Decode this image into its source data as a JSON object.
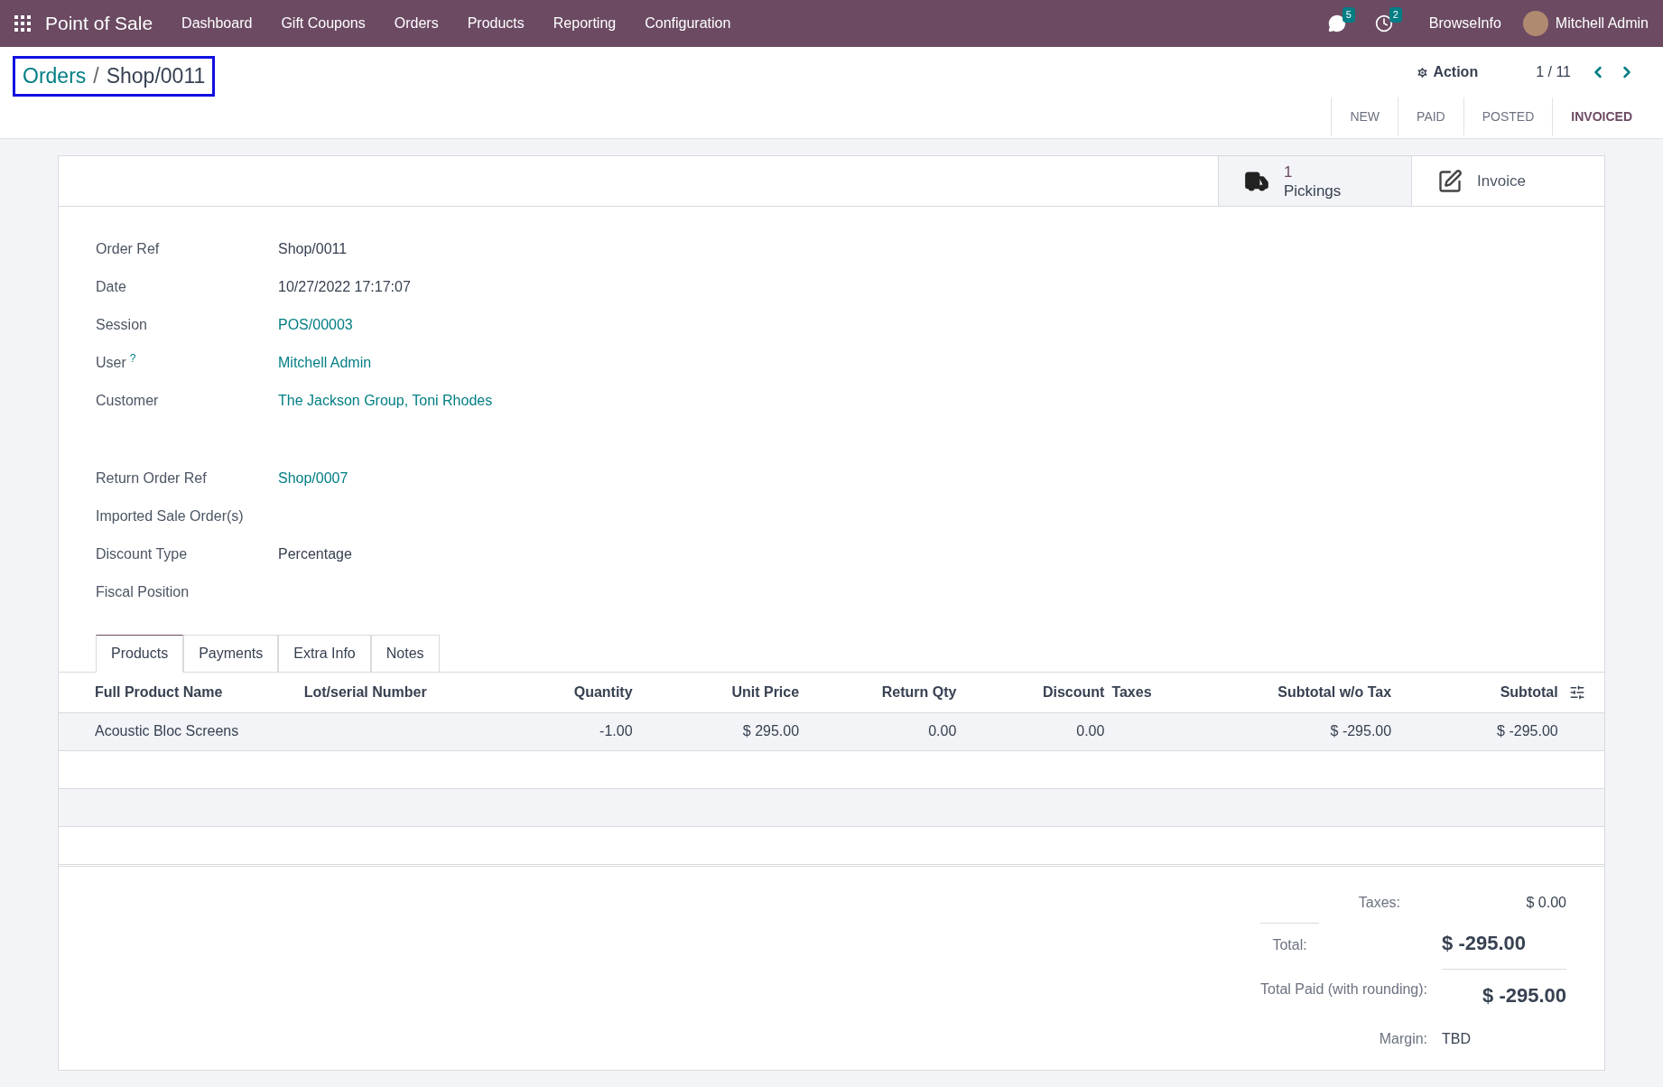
{
  "navbar": {
    "app_name": "Point of Sale",
    "menu": [
      "Dashboard",
      "Gift Coupons",
      "Orders",
      "Products",
      "Reporting",
      "Configuration"
    ],
    "messages_count": "5",
    "activities_count": "2",
    "company": "BrowseInfo",
    "user": "Mitchell Admin"
  },
  "breadcrumb": {
    "parent": "Orders",
    "separator": "/",
    "current": "Shop/0011"
  },
  "action": "Action",
  "pager": "1 / 11",
  "status_steps": [
    {
      "label": "NEW",
      "selected": false
    },
    {
      "label": "PAID",
      "selected": false
    },
    {
      "label": "POSTED",
      "selected": false
    },
    {
      "label": "INVOICED",
      "selected": true
    }
  ],
  "smart_buttons": [
    {
      "kind": "pickings",
      "count": "1",
      "label": "Pickings"
    },
    {
      "kind": "invoice",
      "label": "Invoice"
    }
  ],
  "fields_top": [
    {
      "label": "Order Ref",
      "value": "Shop/0011",
      "kind": "text"
    },
    {
      "label": "Date",
      "value": "10/27/2022 17:17:07",
      "kind": "text"
    },
    {
      "label": "Session",
      "value": "POS/00003",
      "kind": "link"
    },
    {
      "label": "User",
      "help": "?",
      "value": "Mitchell Admin",
      "kind": "link"
    },
    {
      "label": "Customer",
      "value": "The Jackson Group, Toni Rhodes",
      "kind": "link"
    }
  ],
  "fields_bottom": [
    {
      "label": "Return Order Ref",
      "value": "Shop/0007",
      "kind": "link"
    },
    {
      "label": "Imported Sale Order(s)"
    },
    {
      "label": "Discount Type",
      "value": "Percentage",
      "kind": "text"
    },
    {
      "label": "Fiscal Position"
    }
  ],
  "tabs": [
    {
      "label": "Products",
      "selected": true
    },
    {
      "label": "Payments",
      "selected": false
    },
    {
      "label": "Extra Info",
      "selected": false
    },
    {
      "label": "Notes",
      "selected": false
    }
  ],
  "table": {
    "columns": [
      "Full Product Name",
      "Lot/serial Number",
      "Quantity",
      "Unit Price",
      "Return Qty",
      "Discount",
      "Taxes",
      "Subtotal w/o Tax",
      "Subtotal"
    ],
    "rows": [
      [
        "Acoustic Bloc Screens",
        "",
        "-1.00",
        "$ 295.00",
        "0.00",
        "0.00",
        "",
        "$ -295.00",
        "$ -295.00"
      ]
    ]
  },
  "totals": {
    "taxes_label": "Taxes:",
    "taxes": "$ 0.00",
    "total_label": "Total:",
    "total": "$ -295.00",
    "paid_label": "Total Paid (with rounding):",
    "paid": "$ -295.00",
    "margin_label": "Margin:",
    "margin": "TBD"
  }
}
